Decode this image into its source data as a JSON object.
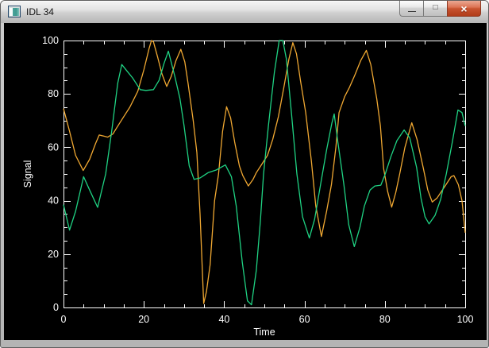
{
  "window": {
    "title": "IDL 34",
    "controls": {
      "minimize_glyph": "—",
      "maximize_glyph": "□",
      "close_glyph": "×"
    }
  },
  "chart_data": {
    "type": "line",
    "title": "",
    "xlabel": "Time",
    "ylabel": "Signal",
    "xlim": [
      0,
      100
    ],
    "ylim": [
      0,
      100
    ],
    "x_ticks": [
      0,
      20,
      40,
      60,
      80,
      100
    ],
    "y_ticks": [
      0,
      20,
      40,
      60,
      80,
      100
    ],
    "minor_tick_interval": 5,
    "grid": false,
    "legend": "none",
    "background": "#000000",
    "axis_color": "#ffffff",
    "series": [
      {
        "name": "orange-signal",
        "color": "#f0a832",
        "points": [
          [
            0,
            74.5
          ],
          [
            1.5,
            66
          ],
          [
            3,
            57
          ],
          [
            4.9,
            51.3
          ],
          [
            6.5,
            55.5
          ],
          [
            8,
            61.5
          ],
          [
            8.9,
            64.6
          ],
          [
            10,
            64.2
          ],
          [
            11,
            63.8
          ],
          [
            12.3,
            65
          ],
          [
            13.2,
            67.2
          ],
          [
            15,
            71.5
          ],
          [
            16.5,
            75
          ],
          [
            18.5,
            81
          ],
          [
            20,
            89
          ],
          [
            21.3,
            97
          ],
          [
            21.9,
            100
          ],
          [
            22.4,
            99.5
          ],
          [
            23.4,
            94
          ],
          [
            24.5,
            87.5
          ],
          [
            25.7,
            82.8
          ],
          [
            26.8,
            86.5
          ],
          [
            28,
            92.5
          ],
          [
            29.2,
            96.7
          ],
          [
            30.2,
            92
          ],
          [
            31,
            84
          ],
          [
            32.3,
            70
          ],
          [
            33.2,
            58
          ],
          [
            34,
            35
          ],
          [
            34.9,
            1.5
          ],
          [
            35.6,
            6
          ],
          [
            36.5,
            16
          ],
          [
            37.6,
            40
          ],
          [
            38.6,
            50
          ],
          [
            39.6,
            66
          ],
          [
            40.6,
            75.2
          ],
          [
            41.6,
            71
          ],
          [
            42.6,
            62
          ],
          [
            43.8,
            53
          ],
          [
            44.6,
            49.5
          ],
          [
            46,
            45.5
          ],
          [
            47.2,
            48
          ],
          [
            48,
            50.5
          ],
          [
            49.5,
            54
          ],
          [
            50.8,
            57
          ],
          [
            52.1,
            63
          ],
          [
            53.5,
            71.5
          ],
          [
            54.8,
            82
          ],
          [
            56.1,
            93
          ],
          [
            57.1,
            99.2
          ],
          [
            58,
            95
          ],
          [
            59,
            85
          ],
          [
            60.3,
            73
          ],
          [
            61.7,
            55
          ],
          [
            62.8,
            38
          ],
          [
            64.2,
            26.6
          ],
          [
            65.5,
            36
          ],
          [
            66.7,
            46
          ],
          [
            67.8,
            60
          ],
          [
            68.6,
            73
          ],
          [
            70,
            79
          ],
          [
            71.2,
            82.5
          ],
          [
            72.5,
            87
          ],
          [
            74,
            92.5
          ],
          [
            75.4,
            96.3
          ],
          [
            76.5,
            91
          ],
          [
            78,
            78
          ],
          [
            78.9,
            68
          ],
          [
            79.7,
            52
          ],
          [
            80.7,
            43.5
          ],
          [
            81.7,
            37.6
          ],
          [
            82.7,
            43
          ],
          [
            83.7,
            50
          ],
          [
            85,
            60
          ],
          [
            86.7,
            69.2
          ],
          [
            88,
            63
          ],
          [
            89.6,
            52
          ],
          [
            90.7,
            44
          ],
          [
            91.8,
            39.5
          ],
          [
            93,
            41
          ],
          [
            95,
            45.5
          ],
          [
            96.5,
            49
          ],
          [
            97.2,
            49.4
          ],
          [
            98.3,
            46
          ],
          [
            99.2,
            40
          ],
          [
            100,
            28
          ]
        ]
      },
      {
        "name": "green-signal",
        "color": "#1fd283",
        "points": [
          [
            0,
            38.5
          ],
          [
            1.5,
            29
          ],
          [
            3,
            36
          ],
          [
            5,
            49
          ],
          [
            6.5,
            44
          ],
          [
            8.5,
            37.5
          ],
          [
            10.5,
            50
          ],
          [
            12,
            66
          ],
          [
            13.5,
            84
          ],
          [
            14.5,
            91
          ],
          [
            15.8,
            88.6
          ],
          [
            17.2,
            86
          ],
          [
            19.1,
            81.6
          ],
          [
            20.5,
            81.3
          ],
          [
            22.4,
            81.6
          ],
          [
            23.8,
            85.1
          ],
          [
            25,
            91.3
          ],
          [
            26.1,
            96
          ],
          [
            27.7,
            86.6
          ],
          [
            29,
            78.2
          ],
          [
            30,
            68.2
          ],
          [
            31.3,
            53
          ],
          [
            32.5,
            48
          ],
          [
            34,
            48.5
          ],
          [
            36,
            50.5
          ],
          [
            38,
            51.5
          ],
          [
            40.3,
            53.4
          ],
          [
            41.8,
            49
          ],
          [
            43,
            38
          ],
          [
            44.5,
            17
          ],
          [
            45.8,
            2.5
          ],
          [
            46.8,
            1
          ],
          [
            48,
            14
          ],
          [
            49,
            32
          ],
          [
            49.8,
            50
          ],
          [
            51,
            68
          ],
          [
            52.5,
            88
          ],
          [
            53.7,
            100
          ],
          [
            54.6,
            100
          ],
          [
            55.5,
            93
          ],
          [
            56.8,
            72
          ],
          [
            58.1,
            50
          ],
          [
            59.5,
            34
          ],
          [
            61.2,
            26
          ],
          [
            62.5,
            33
          ],
          [
            64,
            46
          ],
          [
            65.5,
            59
          ],
          [
            66.8,
            69
          ],
          [
            67.4,
            72.5
          ],
          [
            68.3,
            62
          ],
          [
            69.8,
            46
          ],
          [
            71,
            31
          ],
          [
            72.4,
            22.8
          ],
          [
            73.8,
            30
          ],
          [
            74.9,
            38
          ],
          [
            76.3,
            44
          ],
          [
            77.5,
            45.5
          ],
          [
            79,
            45.8
          ],
          [
            80.1,
            50
          ],
          [
            81.5,
            56.5
          ],
          [
            83,
            62.5
          ],
          [
            84.8,
            66.5
          ],
          [
            86.2,
            63.5
          ],
          [
            87.9,
            52.5
          ],
          [
            89,
            41
          ],
          [
            90,
            34
          ],
          [
            91,
            31.3
          ],
          [
            92.5,
            34.5
          ],
          [
            93.9,
            40.5
          ],
          [
            95.3,
            50
          ],
          [
            96.8,
            62
          ],
          [
            98.2,
            74
          ],
          [
            99.2,
            73
          ],
          [
            100,
            68
          ]
        ]
      }
    ]
  }
}
